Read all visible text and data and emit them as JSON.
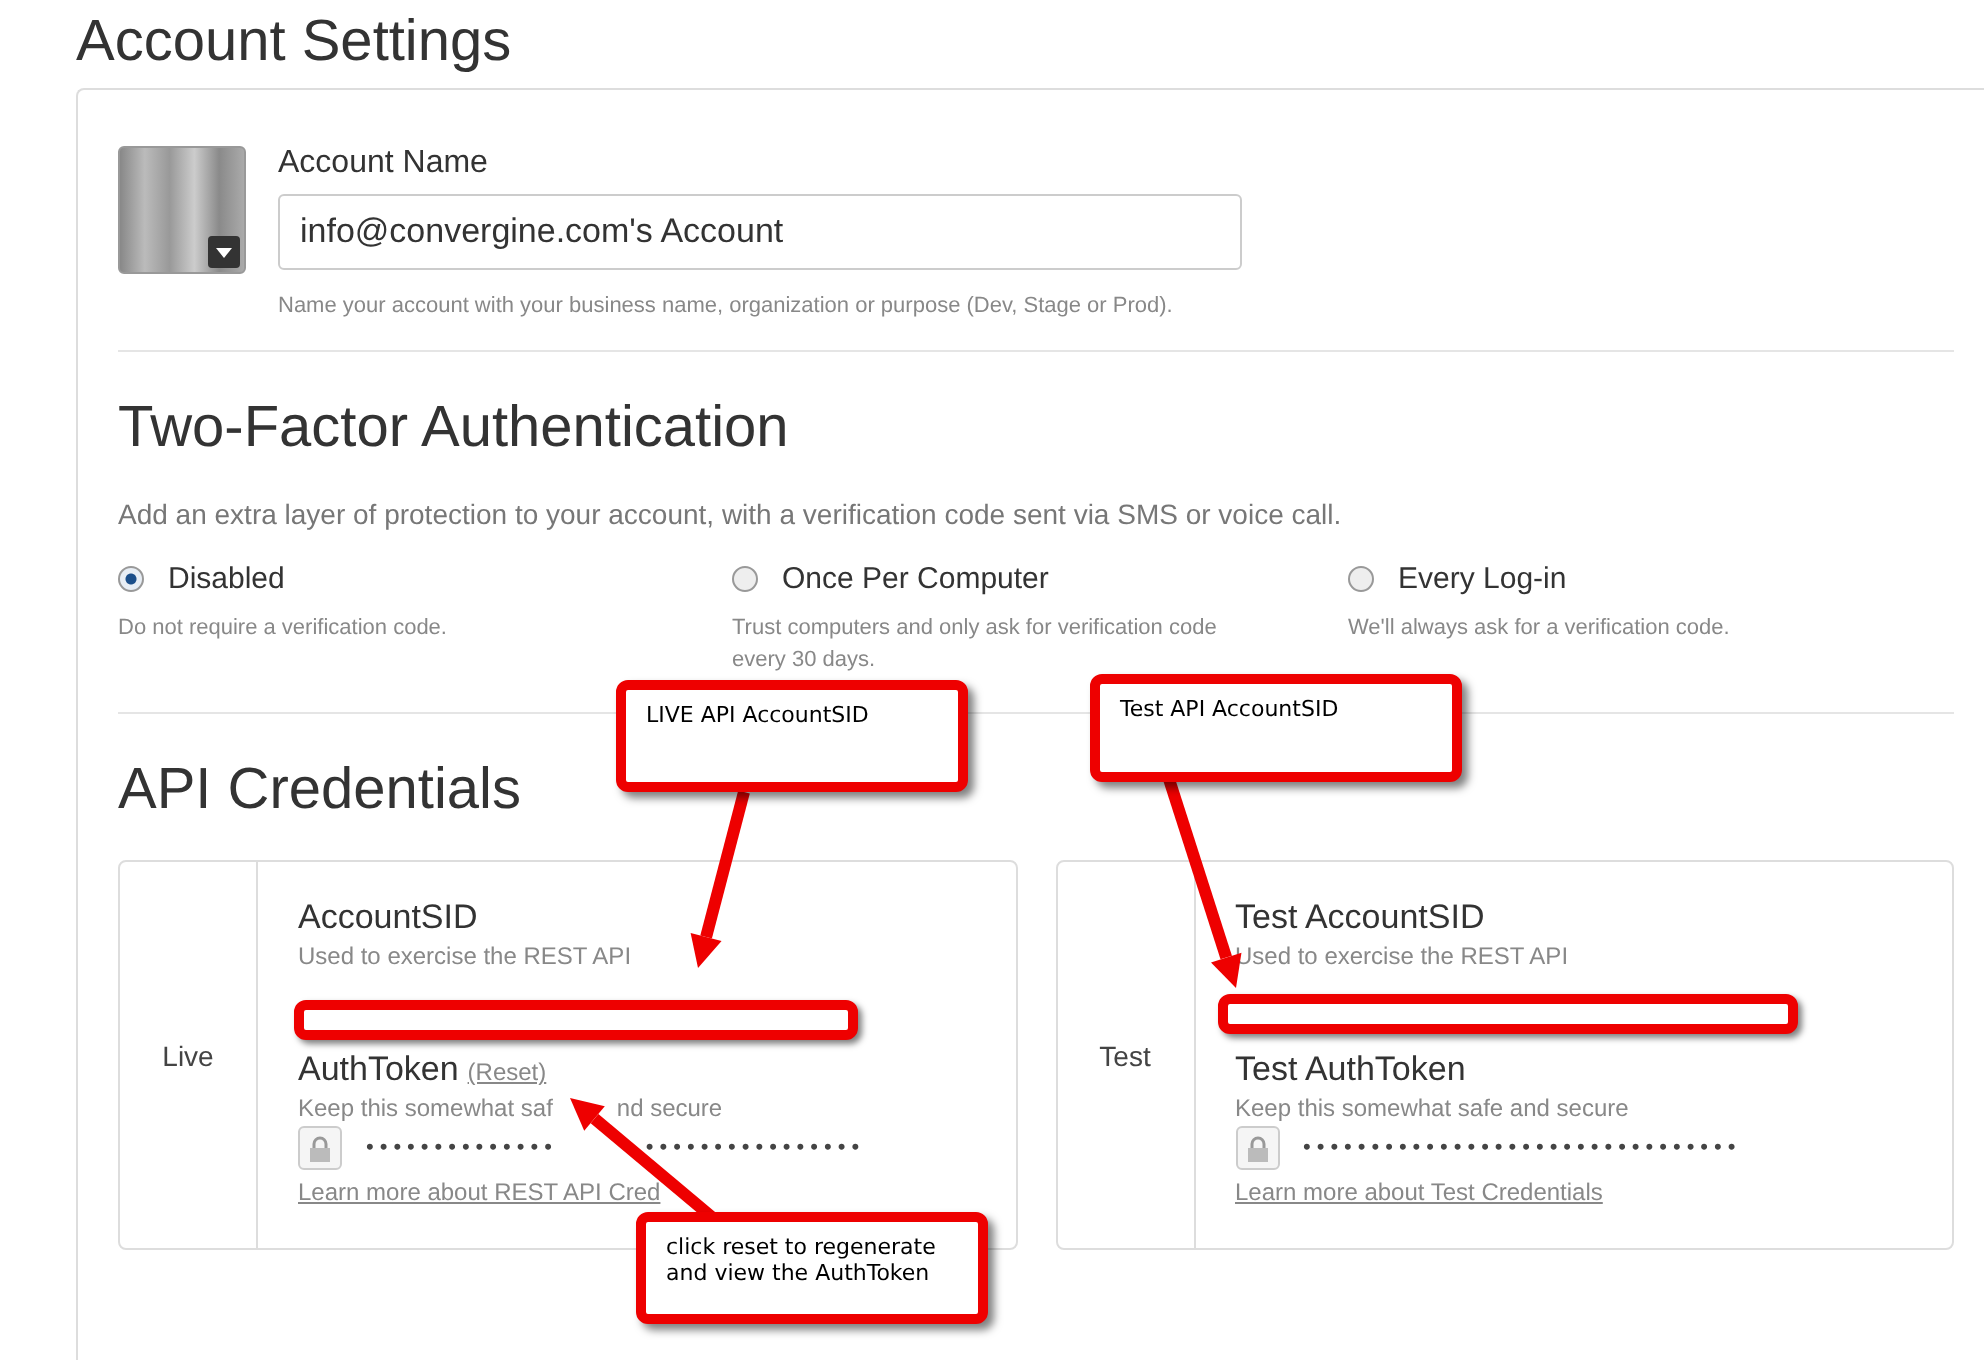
{
  "page_title": "Account Settings",
  "account": {
    "label": "Account Name",
    "value": "info@convergine.com's Account",
    "help": "Name your account with your business name, organization or purpose (Dev, Stage or Prod)."
  },
  "two_factor": {
    "title": "Two-Factor Authentication",
    "description": "Add an extra layer of protection to your account, with a verification code sent via SMS or voice call.",
    "options": [
      {
        "label": "Disabled",
        "description": "Do not require a verification code.",
        "selected": true
      },
      {
        "label": "Once Per Computer",
        "description": "Trust computers and only ask for verification code every 30 days.",
        "selected": false
      },
      {
        "label": "Every Log-in",
        "description": "We'll always ask for a verification code.",
        "selected": false
      }
    ]
  },
  "api": {
    "title": "API Credentials",
    "panels": [
      {
        "env": "Live",
        "sid_label": "AccountSID",
        "sid_help": "Used to exercise the REST API",
        "token_label": "AuthToken",
        "reset_link": "(Reset)",
        "token_help": [
          "Keep this somewhat saf",
          "nd secure"
        ],
        "token_value": [
          "••••••••••••••",
          "••••••••••••••••"
        ],
        "learn_link": "Learn more about REST API Cred"
      },
      {
        "env": "Test",
        "sid_label": "Test AccountSID",
        "sid_help": "Used to exercise the REST API",
        "token_label": "Test AuthToken",
        "token_help": "Keep this somewhat safe and secure",
        "token_value": "••••••••••••••••••••••••••••••••",
        "learn_link": "Learn more about Test Credentials"
      }
    ]
  },
  "annotations": [
    {
      "text": "LIVE API AccountSID"
    },
    {
      "text": "Test API  AccountSID"
    },
    {
      "text": "click reset to regenerate and view the AuthToken"
    }
  ]
}
